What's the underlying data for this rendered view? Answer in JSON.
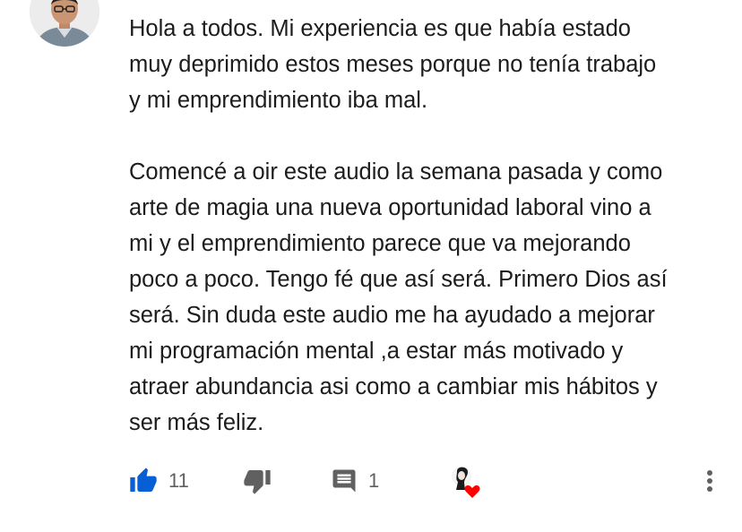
{
  "comment": {
    "paragraph1": [
      "Hola a todos. Mi experiencia es que había estado",
      "muy deprimido estos meses porque no tenía trabajo",
      "y mi emprendimiento iba mal."
    ],
    "paragraph2": [
      "Comencé a oir este audio la semana pasada y como",
      "arte de magia una nueva oportunidad laboral vino a",
      "mi y el emprendimiento parece que va mejorando",
      "poco a poco. Tengo fé que así será. Primero Dios así",
      "será. Sin duda este audio me ha ayudado a mejorar",
      "mi programación mental ,a estar más motivado y",
      "atraer abundancia asi como a cambiar mis hábitos y",
      "ser más feliz."
    ]
  },
  "actions": {
    "like_count": "11",
    "reply_count": "1"
  },
  "colors": {
    "like_active": "#065fd4",
    "icon_gray": "#606060",
    "heart": "#ff0000"
  },
  "icons": {
    "avatar": "user-avatar",
    "like": "thumbs-up-icon",
    "dislike": "thumbs-down-icon",
    "reply": "comment-icon",
    "creator_heart": "creator-heart-icon",
    "more": "more-vert-icon"
  }
}
